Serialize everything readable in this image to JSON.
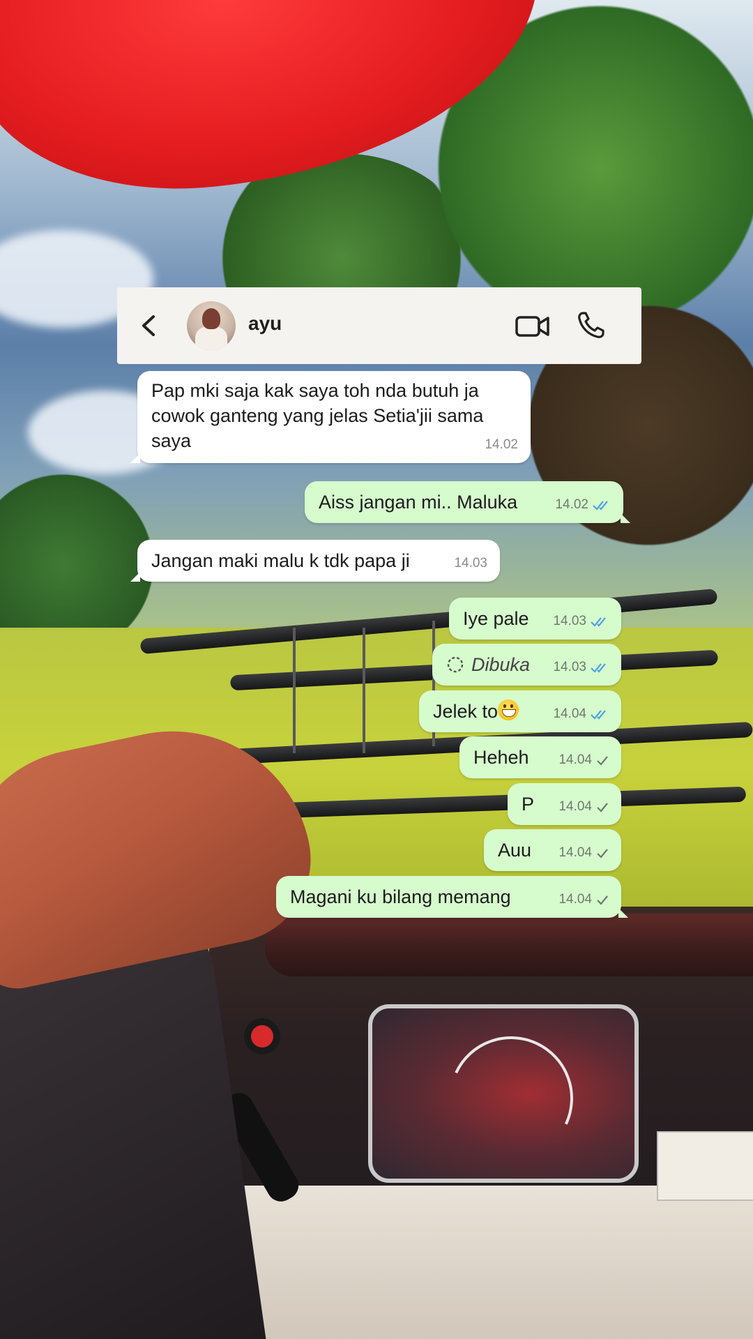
{
  "header": {
    "contact_name": "ayu"
  },
  "colors": {
    "incoming_bubble": "#ffffff",
    "outgoing_bubble": "#d6fbcd",
    "read_tick": "#4fa3e0",
    "sent_tick": "#6f7a6f"
  },
  "messages": [
    {
      "direction": "in",
      "text": "Pap mki saja kak saya toh nda butuh ja\ncowok ganteng yang jelas Setia'jii sama\nsaya",
      "time": "14.02"
    },
    {
      "direction": "out",
      "text": "Aiss jangan mi.. Maluka",
      "time": "14.02",
      "status": "read"
    },
    {
      "direction": "in",
      "text": "Jangan maki malu k tdk papa ji",
      "time": "14.03"
    },
    {
      "direction": "out",
      "text": "Iye pale",
      "time": "14.03",
      "status": "read"
    },
    {
      "direction": "out",
      "text": "Dibuka",
      "time": "14.03",
      "status": "read",
      "icon": "view-once-icon"
    },
    {
      "direction": "out",
      "text": "Jelek to",
      "time": "14.04",
      "status": "read",
      "emoji": "grinning-face-icon"
    },
    {
      "direction": "out",
      "text": "Heheh",
      "time": "14.04",
      "status": "sent"
    },
    {
      "direction": "out",
      "text": "P",
      "time": "14.04",
      "status": "sent"
    },
    {
      "direction": "out",
      "text": "Auu",
      "time": "14.04",
      "status": "sent"
    },
    {
      "direction": "out",
      "text": "Magani ku bilang memang",
      "time": "14.04",
      "status": "sent"
    }
  ]
}
